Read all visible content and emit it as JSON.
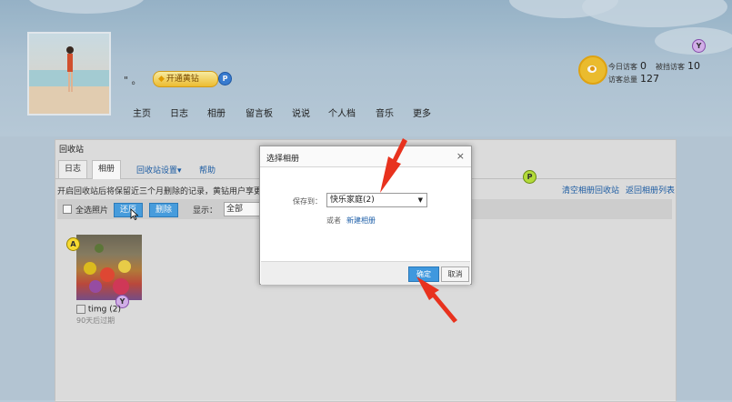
{
  "profile": {
    "nickname": "\" 。",
    "vip_label": "开通黄钻",
    "badge_p": "P",
    "badge_y": "Y"
  },
  "nav": {
    "items": [
      "主页",
      "日志",
      "相册",
      "留言板",
      "说说",
      "个人档",
      "音乐",
      "更多"
    ]
  },
  "visitors": {
    "today_label": "今日访客",
    "today_value": "0",
    "blocked_label": "被挡访客",
    "blocked_value": "10",
    "total_label": "访客总量",
    "total_value": "127"
  },
  "recycle": {
    "title": "回收站",
    "tabs": [
      "日志",
      "相册"
    ],
    "settings_link": "回收站设置▾",
    "help_link": "帮助",
    "info_text": "开启回收站后将保留近三个月删除的记录，黄钻用户享更多保",
    "clear_link": "清空相册回收站",
    "return_link": "返回相册列表",
    "select_all_label": "全选照片",
    "restore_label": "还原",
    "delete_label": "删除",
    "display_label": "显示：",
    "display_value": "全部",
    "badge_pg": "P",
    "badge_a": "A",
    "photo_badge_y": "Y",
    "photo_name": "timg (2)",
    "photo_expire": "90天后过期"
  },
  "dialog": {
    "title": "选择相册",
    "close_icon": "×",
    "save_label": "保存到：",
    "album_value": "快乐家庭(2)",
    "or_label": "或者",
    "create_link": "新建相册",
    "ok_label": "确定",
    "cancel_label": "取消"
  },
  "colors": {
    "arrow": "#e8321e",
    "primary": "#3f98de"
  }
}
